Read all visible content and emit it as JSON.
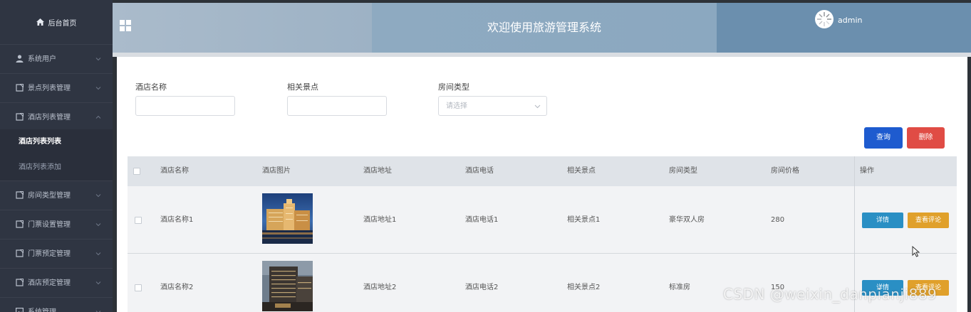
{
  "sidebar": {
    "home_label": "后台首页",
    "items": [
      {
        "label": "系统用户",
        "icon": "user-icon"
      },
      {
        "label": "景点列表管理",
        "icon": "document-icon"
      },
      {
        "label": "酒店列表管理",
        "icon": "document-icon",
        "expanded": true
      },
      {
        "label": "房间类型管理",
        "icon": "document-icon"
      },
      {
        "label": "门票设置管理",
        "icon": "document-icon"
      },
      {
        "label": "门票预定管理",
        "icon": "document-icon"
      },
      {
        "label": "酒店预定管理",
        "icon": "document-icon"
      },
      {
        "label": "系统管理",
        "icon": "image-icon"
      }
    ],
    "subitems": [
      {
        "label": "酒店列表列表",
        "active": true
      },
      {
        "label": "酒店列表添加",
        "active": false
      }
    ]
  },
  "header": {
    "title": "欢迎使用旅游管理系统",
    "username": "admin"
  },
  "filters": {
    "hotel_name_label": "酒店名称",
    "hotel_name_value": "",
    "attraction_label": "相关景点",
    "attraction_value": "",
    "room_type_label": "房间类型",
    "room_type_placeholder": "请选择"
  },
  "actions": {
    "query_label": "查询",
    "delete_label": "删除"
  },
  "table": {
    "columns": [
      "酒店名称",
      "酒店图片",
      "酒店地址",
      "酒店电话",
      "相关景点",
      "房间类型",
      "房间价格",
      "操作"
    ],
    "rows": [
      {
        "name": "酒店名称1",
        "address": "酒店地址1",
        "phone": "酒店电话1",
        "attraction": "相关景点1",
        "room_type": "豪华双人房",
        "price": "280"
      },
      {
        "name": "酒店名称2",
        "address": "酒店地址2",
        "phone": "酒店电话2",
        "attraction": "相关景点2",
        "room_type": "标准房",
        "price": "150"
      }
    ],
    "row_actions": {
      "detail_label": "详情",
      "review_label": "查看评论"
    }
  },
  "watermark": "CSDN @weixin_danpianji889",
  "colors": {
    "sidebar_bg": "#2f3542",
    "query_button": "#1e5bcf",
    "delete_button": "#e04c45",
    "detail_button": "#2a8fc4",
    "review_button": "#e0a02b"
  }
}
